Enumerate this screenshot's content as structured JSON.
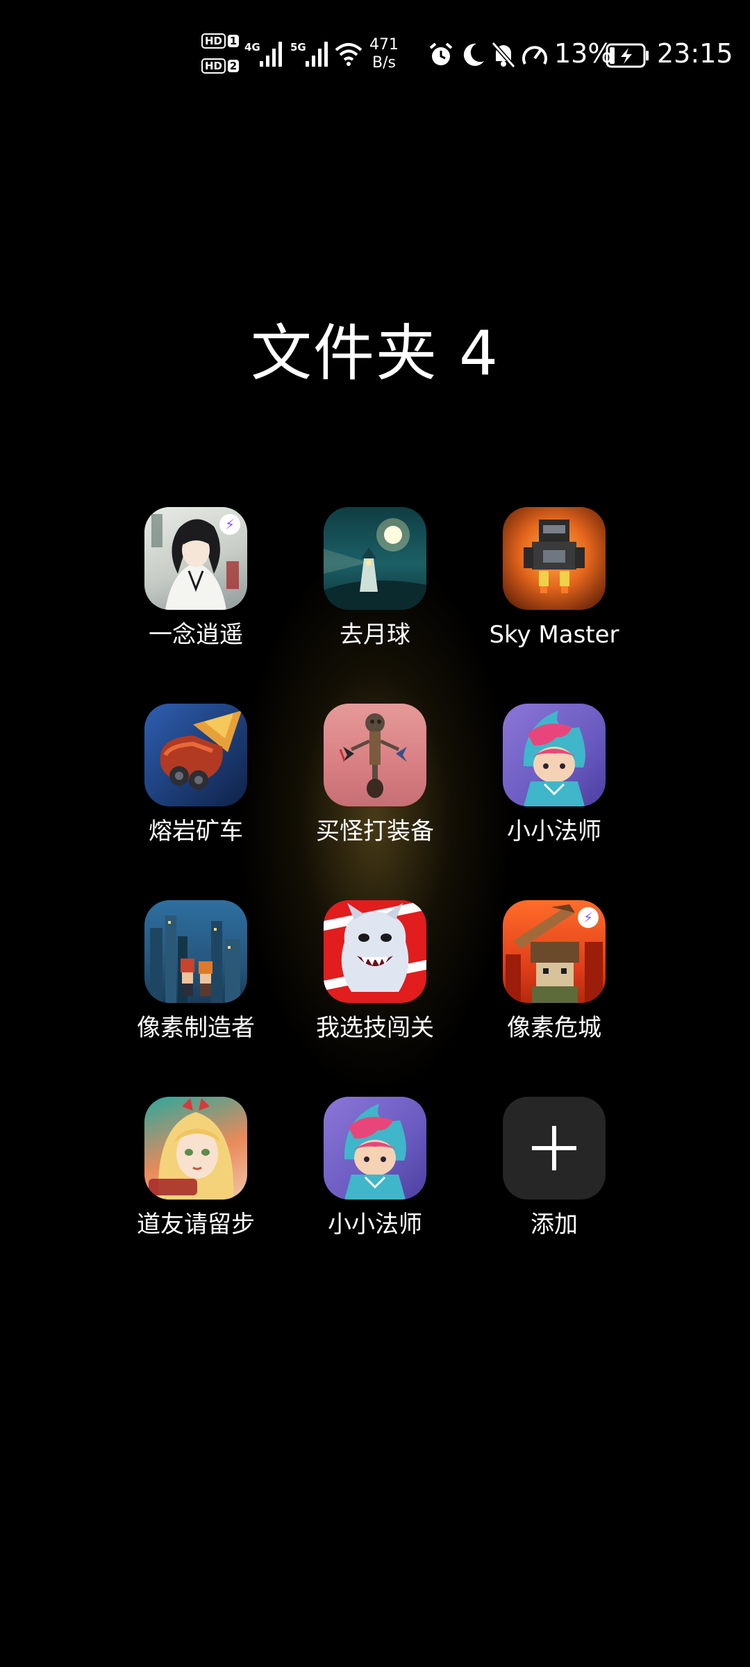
{
  "status_bar": {
    "hd1_badge": "HD",
    "hd1_sim": "1",
    "hd2_badge": "HD",
    "hd2_sim": "2",
    "network_1": "4G",
    "network_2": "5G",
    "speed_value": "471",
    "speed_unit": "B/s",
    "battery_percent": "13%",
    "time": "23:15",
    "icons": [
      "alarm-icon",
      "moon-icon",
      "bell-off-icon",
      "speed-gauge-icon",
      "battery-charging-icon"
    ]
  },
  "folder": {
    "title": "文件夹 4"
  },
  "apps": [
    {
      "label": "一念逍遥",
      "icon": "yinian-xiaoyao-icon"
    },
    {
      "label": "去月球",
      "icon": "to-the-moon-icon"
    },
    {
      "label": "Sky Master",
      "icon": "sky-master-icon"
    },
    {
      "label": "熔岩矿车",
      "icon": "lava-minecart-icon"
    },
    {
      "label": "买怪打装备",
      "icon": "buy-monster-gear-icon"
    },
    {
      "label": "小小法师",
      "icon": "little-mage-icon"
    },
    {
      "label": "像素制造者",
      "icon": "pixel-maker-icon"
    },
    {
      "label": "我选技闯关",
      "icon": "skill-stage-icon"
    },
    {
      "label": "像素危城",
      "icon": "pixel-danger-city-icon"
    },
    {
      "label": "道友请留步",
      "icon": "daoyou-qingliubu-icon"
    },
    {
      "label": "小小法师",
      "icon": "little-mage-icon"
    },
    {
      "label": "添加",
      "icon": "plus-icon"
    }
  ],
  "colors": {
    "background": "#000000",
    "text": "#ffffff",
    "add_tile": "#262626",
    "glow": "#be9b3c"
  }
}
